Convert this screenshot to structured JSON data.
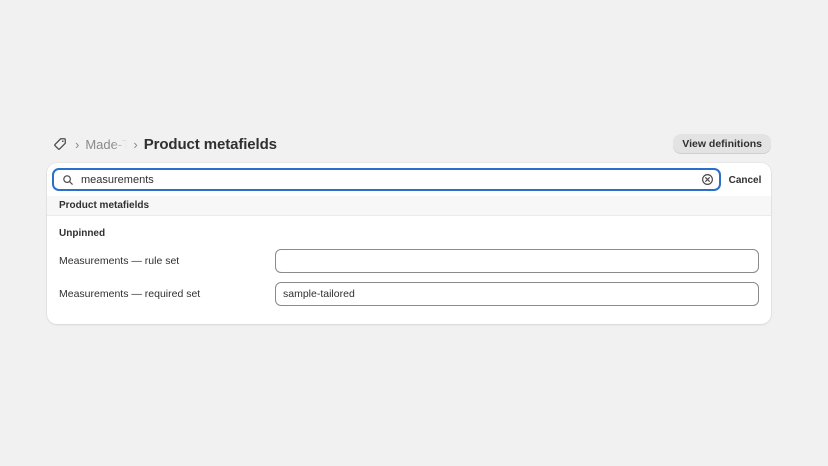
{
  "breadcrumb": {
    "root_icon": "tag-icon",
    "separator": "›",
    "parent_label": "Made-To-Order",
    "title": "Product metafields"
  },
  "header": {
    "view_definitions_label": "View definitions"
  },
  "search": {
    "value": "measurements",
    "placeholder": "Search",
    "cancel_label": "Cancel"
  },
  "list": {
    "section_title": "Product metafields",
    "group_title": "Unpinned",
    "fields": [
      {
        "label": "Measurements — rule set",
        "value": ""
      },
      {
        "label": "Measurements — required set",
        "value": "sample-tailored"
      }
    ]
  },
  "colors": {
    "focus_ring": "#2c6ecb",
    "page_background": "#f1f1f1",
    "card_background": "#ffffff"
  }
}
